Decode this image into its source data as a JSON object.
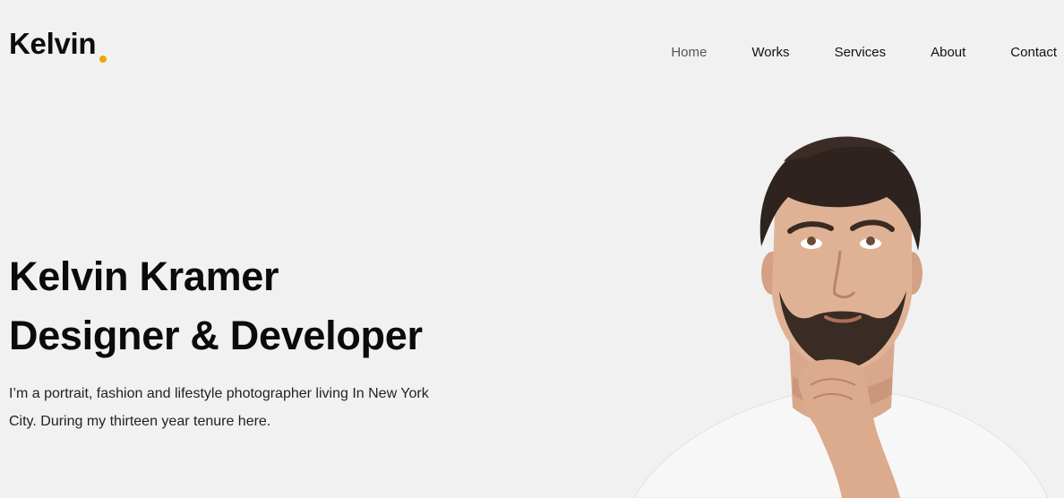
{
  "brand": {
    "logo_text": "Kelvin",
    "accent_color": "#f5a30b"
  },
  "nav": {
    "items": [
      {
        "label": "Home",
        "active": true
      },
      {
        "label": "Works",
        "active": false
      },
      {
        "label": "Services",
        "active": false
      },
      {
        "label": "About",
        "active": false
      },
      {
        "label": "Contact",
        "active": false
      }
    ]
  },
  "hero": {
    "title_line1": "Kelvin Kramer",
    "title_line2": "Designer & Developer",
    "description": "I’m a portrait, fashion and lifestyle photographer living In New York City. During my thirteen year tenure here."
  }
}
